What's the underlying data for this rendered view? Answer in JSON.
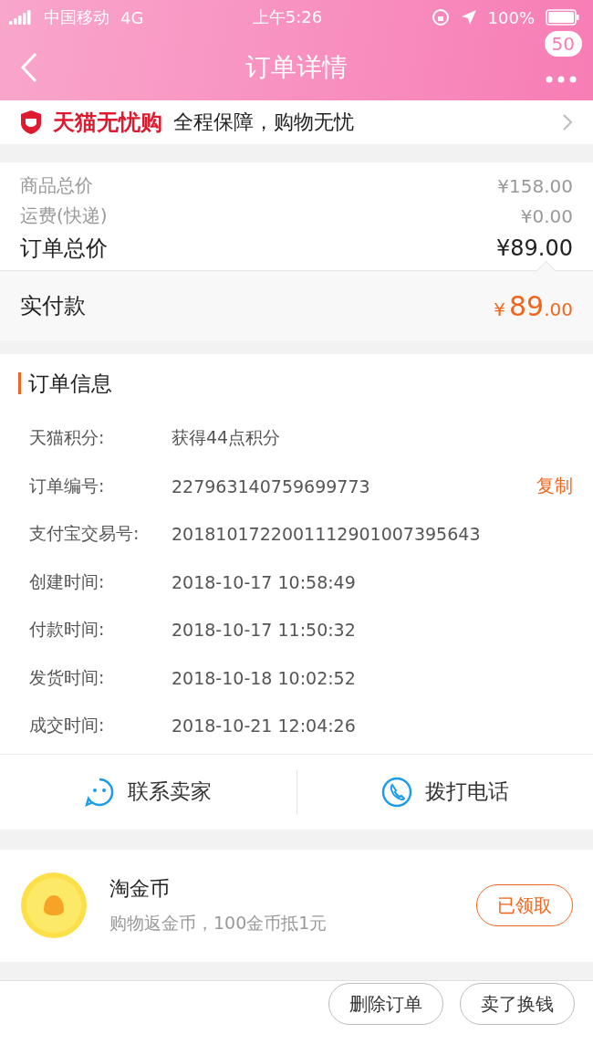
{
  "status_bar": {
    "carrier": "中国移动",
    "network": "4G",
    "time": "上午5:26",
    "battery": "100%"
  },
  "nav": {
    "title": "订单详情",
    "badge": "50"
  },
  "promo": {
    "brand": "天猫无忧购",
    "text": "全程保障，购物无忧"
  },
  "prices": [
    {
      "kind": "minor",
      "label": "商品总价",
      "value": "¥158.00"
    },
    {
      "kind": "minor",
      "label": "运费(快递)",
      "value": "¥0.00"
    },
    {
      "kind": "major",
      "label": "订单总价",
      "value": "¥89.00"
    }
  ],
  "paid": {
    "label": "实付款",
    "currency": "¥",
    "integer": "89",
    "decimal": ".00"
  },
  "order_info": {
    "title": "订单信息",
    "rows": [
      {
        "label": "天猫积分:",
        "value": "获得44点积分"
      },
      {
        "label": "订单编号:",
        "value": "227963140759699773",
        "action": "复制"
      },
      {
        "label": "支付宝交易号:",
        "value": "2018101722001112901007395643"
      },
      {
        "label": "创建时间:",
        "value": "2018-10-17 10:58:49"
      },
      {
        "label": "付款时间:",
        "value": "2018-10-17 11:50:32"
      },
      {
        "label": "发货时间:",
        "value": "2018-10-18 10:02:52"
      },
      {
        "label": "成交时间:",
        "value": "2018-10-21 12:04:26"
      }
    ]
  },
  "contact": [
    {
      "kind": "chat",
      "label": "联系卖家"
    },
    {
      "kind": "phone",
      "label": "拨打电话"
    }
  ],
  "coin": {
    "title": "淘金币",
    "subtitle": "购物返金币，100金币抵1元",
    "button": "已领取"
  },
  "footer_buttons": [
    "删除订单",
    "卖了换钱"
  ]
}
